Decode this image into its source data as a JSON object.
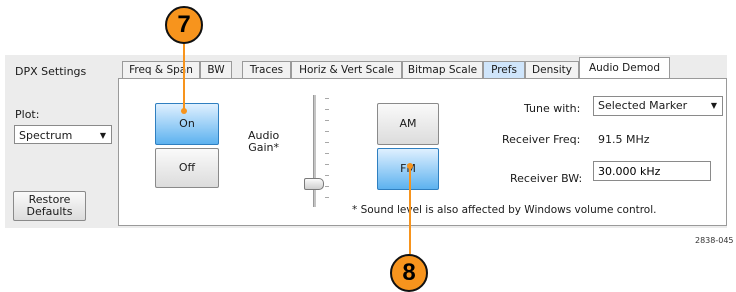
{
  "panel": {
    "title": "DPX Settings",
    "tabs": [
      {
        "label": "Freq & Span"
      },
      {
        "label": "BW"
      },
      {
        "label": "Traces"
      },
      {
        "label": "Horiz & Vert Scale"
      },
      {
        "label": "Bitmap Scale"
      },
      {
        "label": "Prefs"
      },
      {
        "label": "Density"
      },
      {
        "label": "Audio Demod"
      }
    ],
    "active_tab": "Audio Demod"
  },
  "left": {
    "plot_label": "Plot:",
    "plot_value": "Spectrum",
    "restore_line1": "Restore",
    "restore_line2": "Defaults"
  },
  "audio": {
    "on_label": "On",
    "off_label": "Off",
    "on_selected": true,
    "gain_line1": "Audio",
    "gain_line2": "Gain*",
    "gain_level": 0.12
  },
  "demod": {
    "am_label": "AM",
    "fm_label": "FM",
    "selected_mode": "FM"
  },
  "right": {
    "tune_label": "Tune with:",
    "tune_value": "Selected Marker",
    "receiver_freq_label": "Receiver Freq:",
    "receiver_freq_value": "91.5 MHz",
    "receiver_bw_label": "Receiver BW:",
    "receiver_bw_value": "30.000 kHz",
    "note": "* Sound level is also affected by Windows volume control."
  },
  "callouts": {
    "seven": "7",
    "eight": "8"
  },
  "figure_id": "2838-045",
  "colors": {
    "callout": "#f7941d",
    "selected_button": "#5db2ef",
    "blue_tab": "#cfe5fb"
  }
}
